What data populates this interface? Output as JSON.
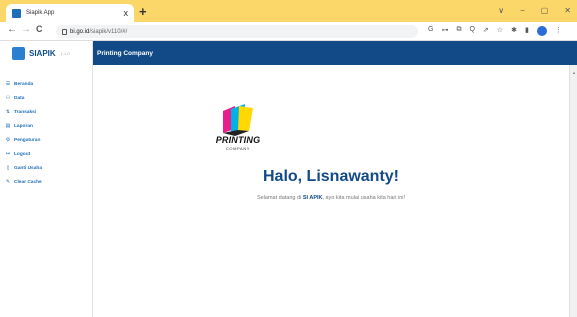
{
  "browser": {
    "tab_title": "Siapik App",
    "tab_close": "x",
    "new_tab": "+",
    "window_controls": [
      "∨",
      "−",
      "▢",
      "✕"
    ],
    "nav": {
      "back": "←",
      "forward": "→",
      "reload": "C"
    },
    "url_host": "bi.go.id",
    "url_path": "/siapik/v110/#/",
    "toolbar_icons": [
      "G",
      "⊶",
      "⧉",
      "Q",
      "⇗",
      "☆",
      "✱",
      "▮"
    ]
  },
  "sidebar": {
    "brand_name": "SIAPIK",
    "brand_version": "1.1.0",
    "items": [
      {
        "icon": "☰",
        "icon_name": "list-icon",
        "label": "Beranda"
      },
      {
        "icon": "⚇",
        "icon_name": "people-icon",
        "label": "Data"
      },
      {
        "icon": "⇅",
        "icon_name": "exchange-icon",
        "label": "Transaksi"
      },
      {
        "icon": "▤",
        "icon_name": "report-icon",
        "label": "Laporan"
      },
      {
        "icon": "⚙",
        "icon_name": "gear-icon",
        "label": "Pengaturan"
      },
      {
        "icon": "↦",
        "icon_name": "logout-icon",
        "label": "Logout"
      },
      {
        "icon": "▯",
        "icon_name": "switch-icon",
        "label": "Ganti Usaha"
      },
      {
        "icon": "✎",
        "icon_name": "broom-icon",
        "label": "Clear Cache"
      }
    ]
  },
  "header": {
    "title": "Printing Company"
  },
  "main": {
    "logo_word": "PRINTING",
    "logo_sub": "COMPANY",
    "greeting": "Halo, Lisnawanty!",
    "welcome_pre": "Selamat datang di ",
    "welcome_brand": "SI APIK",
    "welcome_post": ", ayo kita mulai usaha kita hari ini!"
  },
  "colors": {
    "tabstrip": "#fbd76a",
    "brand_blue": "#124a87",
    "menu_blue": "#1f6fb8"
  }
}
